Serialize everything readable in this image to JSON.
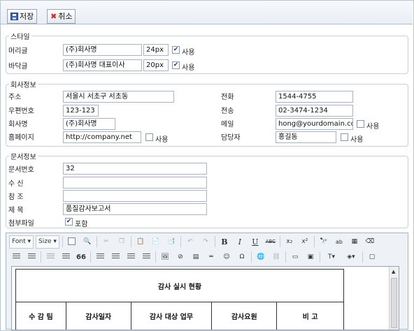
{
  "toolbar": {
    "save_label": "저장",
    "cancel_label": "취소"
  },
  "style_section": {
    "legend": "스타일",
    "header_label": "머리글",
    "header_value": "(주)회사명",
    "header_size": "24px",
    "header_use_label": "사용",
    "footer_label": "바닥글",
    "footer_value": "(주)회사명 대표이사",
    "footer_size": "20px",
    "footer_use_label": "사용",
    "check_mark": "✔"
  },
  "company_section": {
    "legend": "회사정보",
    "address_label": "주소",
    "address_value": "서울시 서초구 서초동",
    "phone_label": "전화",
    "phone_value": "1544-4755",
    "zip_label": "우편번호",
    "zip_value": "123-123",
    "fax_label": "전송",
    "fax_value": "02-3474-1234",
    "company_label": "회사명",
    "company_value": "(주)회사명",
    "email_label": "메일",
    "email_value": "hong@yourdomain.com",
    "email_use_label": "사용",
    "homepage_label": "홈페이지",
    "homepage_value": "http://company.net",
    "homepage_use_label": "사용",
    "manager_label": "담당자",
    "manager_value": "홍길동",
    "manager_use_label": "사용"
  },
  "doc_section": {
    "legend": "문서정보",
    "docno_label": "문서번호",
    "docno_value": "32",
    "recipient_label": "수 신",
    "recipient_value": "",
    "reference_label": "참 조",
    "reference_value": "",
    "subject_label": "제 목",
    "subject_value": "품질감사보고서",
    "attach_label": "첨부파일",
    "attach_include_label": "포함",
    "check_mark": "✔"
  },
  "editor": {
    "font_label": "Font",
    "size_label": "Size",
    "bold": "B",
    "italic": "I",
    "underline": "U",
    "strike": "ABC",
    "subscript": "x₂",
    "superscript": "x²",
    "quote": "66",
    "table_title": "감사 실시 현황",
    "columns": [
      "수 감 팀",
      "감사일자",
      "감사 대상 업무",
      "감사요원",
      "비 고"
    ]
  }
}
